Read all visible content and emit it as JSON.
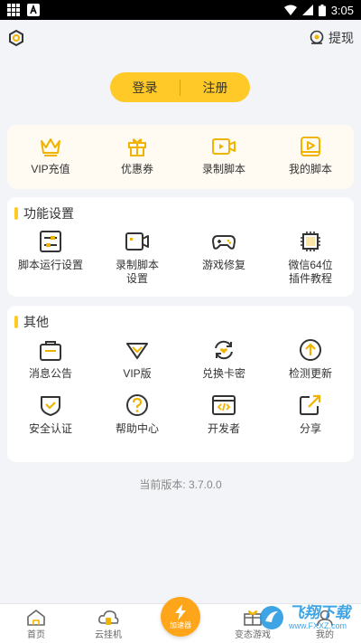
{
  "status_bar": {
    "time": "3:05"
  },
  "header": {
    "withdraw_label": "提现"
  },
  "auth": {
    "login": "登录",
    "register": "注册"
  },
  "quick": [
    {
      "label": "VIP充值",
      "icon": "crown-icon"
    },
    {
      "label": "优惠券",
      "icon": "gift-icon"
    },
    {
      "label": "录制脚本",
      "icon": "video-icon"
    },
    {
      "label": "我的脚本",
      "icon": "script-play-icon"
    }
  ],
  "functions": {
    "title": "功能设置",
    "items": [
      {
        "label": "脚本运行设置",
        "icon": "sliders-icon"
      },
      {
        "label": "录制脚本\n设置",
        "icon": "camera-icon"
      },
      {
        "label": "游戏修复",
        "icon": "gamepad-icon"
      },
      {
        "label": "微信64位\n插件教程",
        "icon": "chip-icon"
      }
    ]
  },
  "others": {
    "title": "其他",
    "items": [
      {
        "label": "消息公告",
        "icon": "bag-icon"
      },
      {
        "label": "VIP版",
        "icon": "diamond-icon"
      },
      {
        "label": "兑换卡密",
        "icon": "exchange-icon"
      },
      {
        "label": "检测更新",
        "icon": "upload-icon"
      },
      {
        "label": "安全认证",
        "icon": "shield-icon"
      },
      {
        "label": "帮助中心",
        "icon": "help-icon"
      },
      {
        "label": "开发者",
        "icon": "code-icon"
      },
      {
        "label": "分享",
        "icon": "share-icon"
      }
    ]
  },
  "version_text": "当前版本: 3.7.0.0",
  "tabbar": {
    "home": "首页",
    "cloud": "云挂机",
    "boost": "加速器",
    "games": "变态游戏",
    "mine": "我的"
  },
  "watermark": {
    "text": "飞翔下载",
    "url": "www.FXXZ.com"
  },
  "colors": {
    "accent": "#ffc928",
    "icon_gold": "#f0b400",
    "boost": "#ffa51a"
  }
}
